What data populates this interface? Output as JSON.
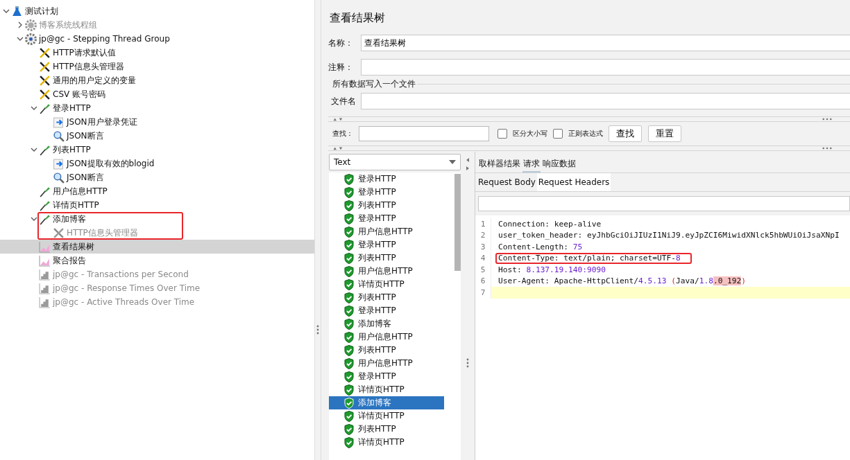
{
  "tree": [
    {
      "label": "测试计划",
      "kind": "plan",
      "expanded": true,
      "disabled": false,
      "selected": false,
      "children": [
        {
          "label": "博客系统线程组",
          "kind": "threadgroup",
          "expanded": false,
          "disabled": true,
          "selected": false
        },
        {
          "label": "jp@gc - Stepping Thread Group",
          "kind": "threadgroup",
          "expanded": true,
          "disabled": false,
          "selected": false,
          "children": [
            {
              "label": "HTTP请求默认值",
              "kind": "config",
              "disabled": false,
              "selected": false
            },
            {
              "label": "HTTP信息头管理器",
              "kind": "config",
              "disabled": false,
              "selected": false
            },
            {
              "label": "通用的用户定义的变量",
              "kind": "config",
              "disabled": false,
              "selected": false
            },
            {
              "label": "CSV 账号密码",
              "kind": "config",
              "disabled": false,
              "selected": false
            },
            {
              "label": "登录HTTP",
              "kind": "sampler",
              "expanded": true,
              "disabled": false,
              "selected": false,
              "children": [
                {
                  "label": "JSON用户登录凭证",
                  "kind": "extractor",
                  "disabled": false,
                  "selected": false
                },
                {
                  "label": "JSON断言",
                  "kind": "assertion",
                  "disabled": false,
                  "selected": false
                }
              ]
            },
            {
              "label": "列表HTTP",
              "kind": "sampler",
              "expanded": true,
              "disabled": false,
              "selected": false,
              "children": [
                {
                  "label": "JSON提取有效的blogid",
                  "kind": "extractor",
                  "disabled": false,
                  "selected": false
                },
                {
                  "label": "JSON断言",
                  "kind": "assertion",
                  "disabled": false,
                  "selected": false
                }
              ]
            },
            {
              "label": "用户信息HTTP",
              "kind": "sampler",
              "disabled": false,
              "selected": false
            },
            {
              "label": "详情页HTTP",
              "kind": "sampler",
              "disabled": false,
              "selected": false
            },
            {
              "label": "添加博客",
              "kind": "sampler",
              "expanded": true,
              "disabled": false,
              "selected": false,
              "highlighted": true,
              "children": [
                {
                  "label": "HTTP信息头管理器",
                  "kind": "config",
                  "disabled": true,
                  "selected": false
                }
              ]
            },
            {
              "label": "查看结果树",
              "kind": "listener",
              "disabled": false,
              "selected": true
            },
            {
              "label": "聚合报告",
              "kind": "listener",
              "disabled": false,
              "selected": false
            },
            {
              "label": "jp@gc - Transactions per Second",
              "kind": "graph",
              "disabled": true,
              "selected": false
            },
            {
              "label": "jp@gc - Response Times Over Time",
              "kind": "graph",
              "disabled": true,
              "selected": false
            },
            {
              "label": "jp@gc - Active Threads Over Time",
              "kind": "graph",
              "disabled": true,
              "selected": false
            }
          ]
        }
      ]
    }
  ],
  "panel": {
    "title": "查看结果树",
    "name_label": "名称：",
    "name_value": "查看结果树",
    "comment_label": "注释：",
    "file_group": "所有数据写入一个文件",
    "file_label": "文件名"
  },
  "search": {
    "label": "查找：",
    "case_label": "区分大小写",
    "case_checked": false,
    "regex_label": "正则表达式",
    "regex_checked": false,
    "find_button": "查找",
    "reset_button": "重置"
  },
  "renderer": {
    "value": "Text"
  },
  "samples": [
    {
      "label": "登录HTTP",
      "selected": false
    },
    {
      "label": "登录HTTP",
      "selected": false
    },
    {
      "label": "列表HTTP",
      "selected": false
    },
    {
      "label": "登录HTTP",
      "selected": false
    },
    {
      "label": "用户信息HTTP",
      "selected": false
    },
    {
      "label": "登录HTTP",
      "selected": false
    },
    {
      "label": "列表HTTP",
      "selected": false
    },
    {
      "label": "用户信息HTTP",
      "selected": false
    },
    {
      "label": "详情页HTTP",
      "selected": false
    },
    {
      "label": "列表HTTP",
      "selected": false
    },
    {
      "label": "登录HTTP",
      "selected": false
    },
    {
      "label": "添加博客",
      "selected": false
    },
    {
      "label": "用户信息HTTP",
      "selected": false
    },
    {
      "label": "列表HTTP",
      "selected": false
    },
    {
      "label": "用户信息HTTP",
      "selected": false
    },
    {
      "label": "登录HTTP",
      "selected": false
    },
    {
      "label": "详情页HTTP",
      "selected": false
    },
    {
      "label": "添加博客",
      "selected": true
    },
    {
      "label": "详情页HTTP",
      "selected": false
    },
    {
      "label": "列表HTTP",
      "selected": false
    },
    {
      "label": "详情页HTTP",
      "selected": false
    }
  ],
  "result_tabs": [
    {
      "label": "取样器结果",
      "selected": false
    },
    {
      "label": "请求",
      "selected": true
    },
    {
      "label": "响应数据",
      "selected": false
    }
  ],
  "request_tabs": [
    {
      "label": "Request Body",
      "selected": false
    },
    {
      "label": "Request Headers",
      "selected": true
    }
  ],
  "code": [
    {
      "number": "1",
      "current": false,
      "highlighted": false,
      "tokens": [
        {
          "kind": "plain",
          "text": "Connection: keep-alive"
        }
      ]
    },
    {
      "number": "2",
      "current": false,
      "highlighted": false,
      "tokens": [
        {
          "kind": "plain",
          "text": "user_token_header: eyJhbGciOiJIUzI1NiJ9.eyJpZCI6MiwidXNlck5hbWUiOiJsaXNpI"
        }
      ]
    },
    {
      "number": "3",
      "current": false,
      "highlighted": false,
      "tokens": [
        {
          "kind": "plain",
          "text": "Content-Length: "
        },
        {
          "kind": "number",
          "text": "75"
        }
      ]
    },
    {
      "number": "4",
      "current": false,
      "highlighted": true,
      "tokens": [
        {
          "kind": "plain",
          "text": "Content-Type: text/plain; charset=UTF-"
        },
        {
          "kind": "number",
          "text": "8"
        }
      ]
    },
    {
      "number": "5",
      "current": false,
      "highlighted": false,
      "tokens": [
        {
          "kind": "plain",
          "text": "Host: "
        },
        {
          "kind": "number",
          "text": "8.137.19.140:9090"
        }
      ]
    },
    {
      "number": "6",
      "current": false,
      "highlighted": false,
      "tokens": [
        {
          "kind": "plain",
          "text": "User-Agent: Apache-HttpClient/"
        },
        {
          "kind": "number",
          "text": "4.5.13"
        },
        {
          "kind": "paren",
          "text": " ("
        },
        {
          "kind": "plain",
          "text": "Java/"
        },
        {
          "kind": "number",
          "text": "1.8"
        },
        {
          "kind": "marked",
          "text": ".0_192"
        },
        {
          "kind": "paren",
          "text": ")"
        }
      ]
    },
    {
      "number": "7",
      "current": true
    }
  ]
}
